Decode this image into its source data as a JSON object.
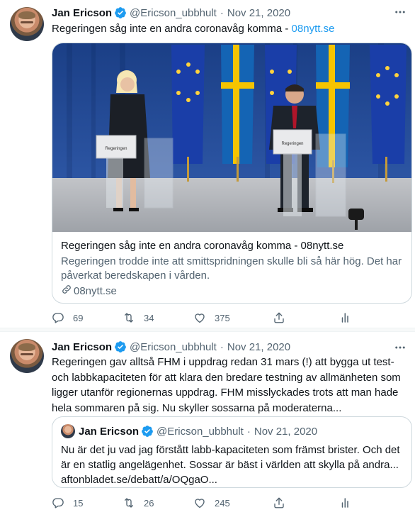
{
  "tweets": [
    {
      "author_name": "Jan Ericson",
      "handle": "@Ericson_ubbhult",
      "date": "Nov 21, 2020",
      "text": "Regeringen såg inte en andra coronavåg komma - ",
      "text_link": "08nytt.se",
      "card": {
        "title": "Regeringen såg inte en andra coronavåg komma - 08nytt.se",
        "description": "Regeringen trodde inte att smittspridningen skulle bli så här hög. Det har påverkat beredskapen i vården.",
        "domain": "08nytt.se",
        "image_sign_left": "Regeringen",
        "image_sign_right": "Regeringen"
      },
      "actions": {
        "replies": "69",
        "retweets": "34",
        "likes": "375"
      }
    },
    {
      "author_name": "Jan Ericson",
      "handle": "@Ericson_ubbhult",
      "date": "Nov 21, 2020",
      "text": "Regeringen gav alltså FHM i uppdrag redan 31 mars (!) att bygga ut test- och labbkapaciteten för att klara den bredare testning av allmänheten som ligger utanför regionernas uppdrag. FHM misslyckades trots att man hade hela sommaren på sig. Nu skyller sossarna på moderaterna...",
      "quote": {
        "author_name": "Jan Ericson",
        "handle": "@Ericson_ubbhult",
        "date": "Nov 21, 2020",
        "text": "Nu är det ju vad jag förstått labb-kapaciteten som främst brister. Och det är en statlig angelägenhet. Sossar är bäst i världen att skylla på andra... aftonbladet.se/debatt/a/OQgaO..."
      },
      "actions": {
        "replies": "15",
        "retweets": "26",
        "likes": "245"
      }
    }
  ],
  "separator_dot": "·",
  "colors": {
    "accent": "#1d9bf0",
    "text": "#0f1419",
    "muted": "#536471",
    "border": "#cfd9de"
  },
  "icons": [
    "verified-badge-icon",
    "more-icon",
    "reply-icon",
    "retweet-icon",
    "like-icon",
    "share-icon",
    "analytics-icon",
    "link-icon"
  ]
}
